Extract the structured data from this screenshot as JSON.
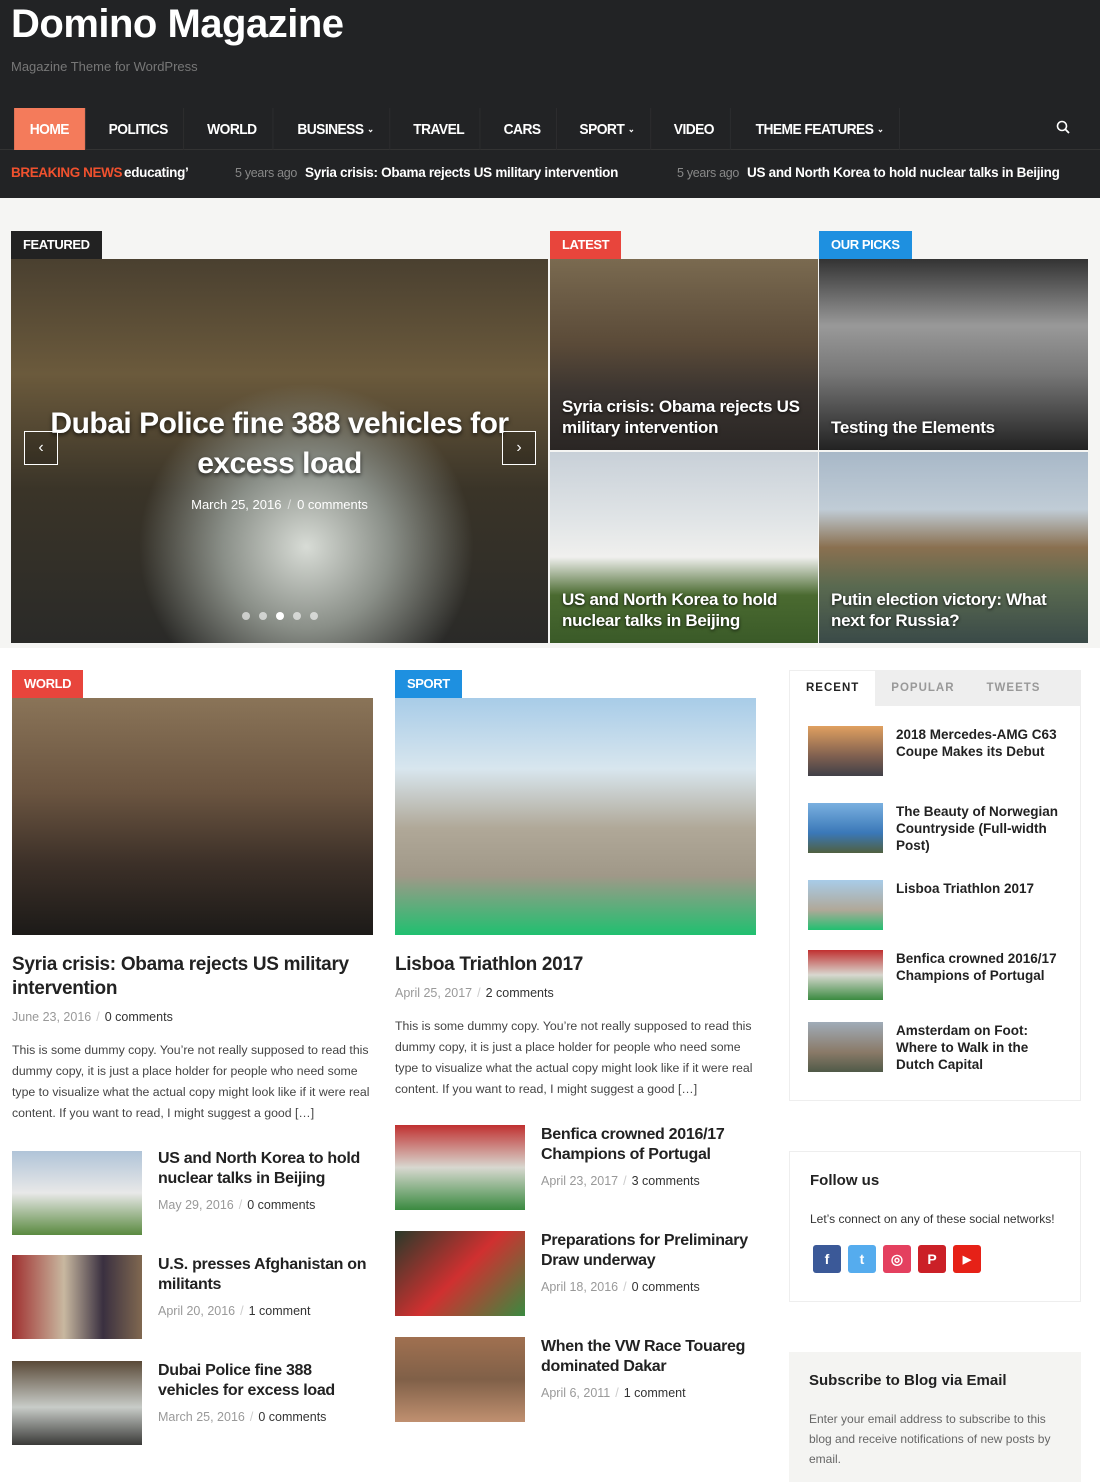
{
  "header": {
    "site_title": "Domino Magazine",
    "tagline": "Magazine Theme for WordPress"
  },
  "nav": {
    "items": [
      {
        "label": "HOME",
        "active": true
      },
      {
        "label": "POLITICS"
      },
      {
        "label": "WORLD"
      },
      {
        "label": "BUSINESS",
        "dropdown": true
      },
      {
        "label": "TRAVEL"
      },
      {
        "label": "CARS"
      },
      {
        "label": "SPORT",
        "dropdown": true
      },
      {
        "label": "VIDEO"
      },
      {
        "label": "THEME FEATURES",
        "dropdown": true
      }
    ],
    "search_icon": "search-icon",
    "accent": "#f47b5b"
  },
  "breaking": {
    "label": "BREAKING NEWS",
    "items": [
      {
        "ago": "",
        "title": "educating’"
      },
      {
        "ago": "5 years ago",
        "title": "Syria crisis: Obama rejects US military intervention"
      },
      {
        "ago": "5 years ago",
        "title": "US and North Korea to hold nuclear talks in Beijing"
      }
    ]
  },
  "featured": {
    "label": "FEATURED",
    "title": "Dubai Police fine 388 vehicles for excess load",
    "date": "March 25, 2016",
    "comments": "0 comments",
    "slides": 5,
    "active_slide": 3
  },
  "latest": {
    "label": "LATEST",
    "posts": [
      {
        "title": "Syria crisis: Obama rejects US military intervention"
      },
      {
        "title": "US and North Korea to hold nuclear talks in Beijing"
      }
    ]
  },
  "picks": {
    "label": "OUR PICKS",
    "posts": [
      {
        "title": "Testing the Elements"
      },
      {
        "title": "Putin election victory: What next for Russia?"
      }
    ]
  },
  "world": {
    "label": "WORLD",
    "main": {
      "title": "Syria crisis: Obama rejects US military intervention",
      "date": "June 23, 2016",
      "comments": "0 comments",
      "excerpt": "This is some dummy copy. You’re not really supposed to read this dummy copy, it is just a place holder for people who need some type to visualize what the actual copy might look like if it were real content. If you want to read, I might suggest a good […]"
    },
    "list": [
      {
        "title": "US and North Korea to hold nuclear talks in Beijing",
        "date": "May 29, 2016",
        "comments": "0 comments"
      },
      {
        "title": "U.S. presses Afghanistan on militants",
        "date": "April 20, 2016",
        "comments": "1 comment"
      },
      {
        "title": "Dubai Police fine 388 vehicles for excess load",
        "date": "March 25, 2016",
        "comments": "0 comments"
      }
    ]
  },
  "sport": {
    "label": "SPORT",
    "main": {
      "title": "Lisboa Triathlon 2017",
      "date": "April 25, 2017",
      "comments": "2 comments",
      "excerpt": "This is some dummy copy. You’re not really supposed to read this dummy copy, it is just a place holder for people who need some type to visualize what the actual copy might look like if it were real content. If you want to read, I might suggest a good […]"
    },
    "list": [
      {
        "title": "Benfica crowned 2016/17 Champions of Portugal",
        "date": "April 23, 2017",
        "comments": "3 comments"
      },
      {
        "title": "Preparations for Preliminary Draw underway",
        "date": "April 18, 2016",
        "comments": "0 comments"
      },
      {
        "title": "When the VW Race Touareg dominated Dakar",
        "date": "April 6, 2011",
        "comments": "1 comment"
      }
    ]
  },
  "sidebar": {
    "tabs": [
      "RECENT",
      "POPULAR",
      "TWEETS"
    ],
    "active_tab": "RECENT",
    "recent": [
      {
        "title": "2018 Mercedes-AMG C63 Coupe Makes its Debut"
      },
      {
        "title": "The Beauty of Norwegian Countryside (Full-width Post)"
      },
      {
        "title": "Lisboa Triathlon 2017"
      },
      {
        "title": "Benfica crowned 2016/17 Champions of Portugal"
      },
      {
        "title": "Amsterdam on Foot: Where to Walk in the Dutch Capital"
      }
    ],
    "follow": {
      "title": "Follow us",
      "text": "Let’s connect on any of these social networks!",
      "networks": [
        {
          "name": "facebook",
          "color": "#3b5998",
          "glyph": "f"
        },
        {
          "name": "twitter",
          "color": "#55acee",
          "glyph": "t"
        },
        {
          "name": "instagram",
          "color": "#e4405f",
          "glyph": "◎"
        },
        {
          "name": "pinterest",
          "color": "#cb2027",
          "glyph": "P"
        },
        {
          "name": "youtube",
          "color": "#e62117",
          "glyph": "▶"
        }
      ]
    },
    "subscribe": {
      "title": "Subscribe to Blog via Email",
      "text": "Enter your email address to subscribe to this blog and receive notifications of new posts by email."
    }
  },
  "colors": {
    "featured": "#222",
    "latest": "#e8453c",
    "picks": "#1e90e0",
    "world": "#e8453c",
    "sport": "#1e90e0"
  }
}
